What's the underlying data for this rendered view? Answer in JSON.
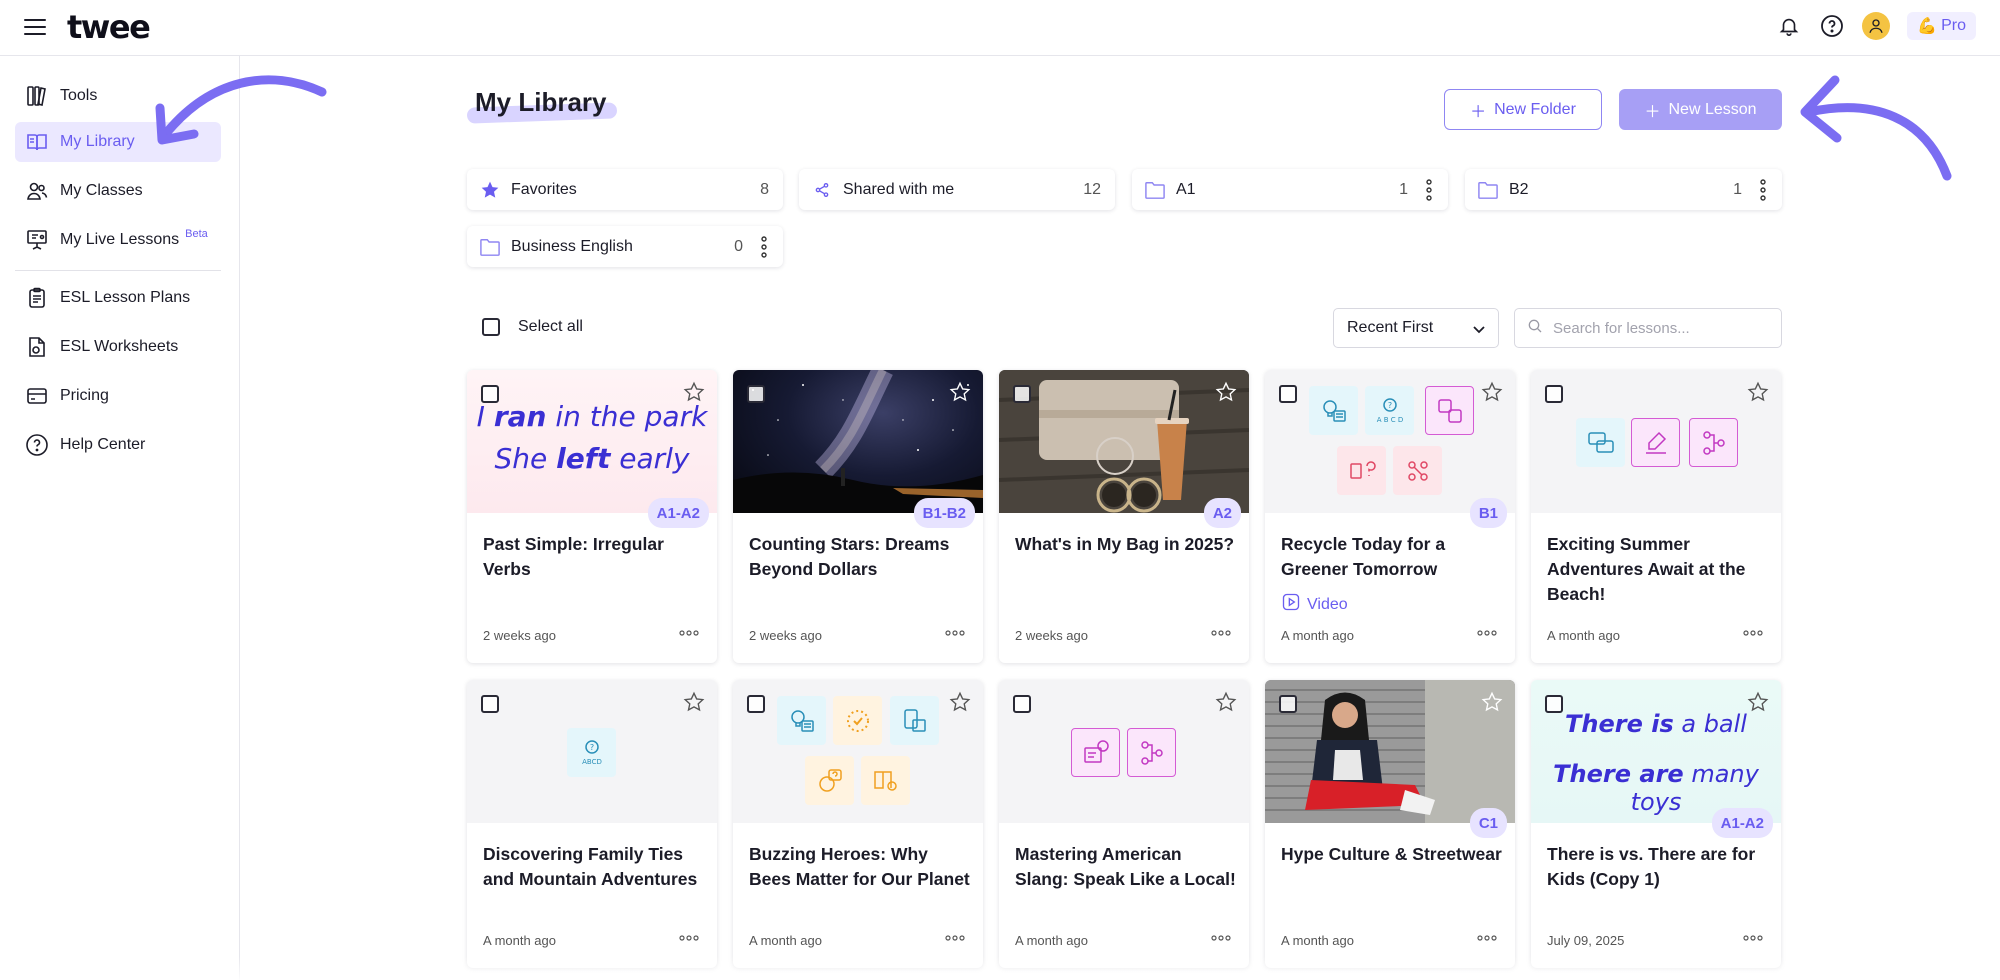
{
  "header": {
    "logo": "twee",
    "pro_label": "Pro",
    "pro_emoji": "💪"
  },
  "sidebar": {
    "items": [
      {
        "label": "Tools",
        "icon": "tools-icon"
      },
      {
        "label": "My Library",
        "icon": "book-icon",
        "active": true
      },
      {
        "label": "My Classes",
        "icon": "users-icon"
      },
      {
        "label": "My Live Lessons",
        "icon": "presentation-icon",
        "badge": "Beta"
      },
      {
        "label": "ESL Lesson Plans",
        "icon": "clipboard-icon"
      },
      {
        "label": "ESL Worksheets",
        "icon": "worksheet-icon"
      },
      {
        "label": "Pricing",
        "icon": "credit-card-icon"
      },
      {
        "label": "Help Center",
        "icon": "help-icon"
      }
    ]
  },
  "main": {
    "title": "My Library",
    "new_folder_label": "New Folder",
    "new_lesson_label": "New Lesson",
    "folders": [
      {
        "label": "Favorites",
        "count": "8",
        "icon": "star-icon"
      },
      {
        "label": "Shared with me",
        "count": "12",
        "icon": "share-icon"
      },
      {
        "label": "A1",
        "count": "1",
        "icon": "folder-icon"
      },
      {
        "label": "B2",
        "count": "1",
        "icon": "folder-icon"
      },
      {
        "label": "Business English",
        "count": "0",
        "icon": "folder-icon"
      }
    ],
    "select_all_label": "Select all",
    "sort_value": "Recent First",
    "search_placeholder": "Search for lessons..."
  },
  "cards": [
    {
      "title": "Past Simple: Irregular Verbs",
      "level": "A1-A2",
      "date": "2 weeks ago",
      "thumb_line1_pre": "I ",
      "thumb_line1_bold": "ran",
      "thumb_line1_post": " in the park",
      "thumb_line2_pre": "She ",
      "thumb_line2_bold": "left",
      "thumb_line2_post": " early"
    },
    {
      "title": "Counting Stars: Dreams Beyond Dollars",
      "level": "B1-B2",
      "date": "2 weeks ago"
    },
    {
      "title": "What's in My Bag in 2025?",
      "level": "A2",
      "date": "2 weeks ago"
    },
    {
      "title": "Recycle Today for a Greener Tomorrow",
      "level": "B1",
      "date": "A month ago",
      "video_label": "Video"
    },
    {
      "title": "Exciting Summer Adventures Await at the Beach!",
      "date": "A month ago"
    },
    {
      "title": "Discovering Family Ties and Mountain Adventures",
      "date": "A month ago",
      "thumb_quiz": "ABCD"
    },
    {
      "title": "Buzzing Heroes: Why Bees Matter for Our Planet",
      "date": "A month ago"
    },
    {
      "title": "Mastering American Slang: Speak Like a Local!",
      "date": "A month ago"
    },
    {
      "title": "Hype Culture & Streetwear",
      "level": "C1",
      "date": "A month ago"
    },
    {
      "title": "There is vs. There are for Kids (Copy 1)",
      "level": "A1-A2",
      "date": "July 09, 2025",
      "thumb_line1_pre": "",
      "thumb_line1_bold": "There is",
      "thumb_line1_post": " a ball",
      "thumb_line2_pre": "",
      "thumb_line2_bold": "There are",
      "thumb_line2_post": " many toys"
    }
  ],
  "colors": {
    "accent": "#6a5df0",
    "accent_light": "#ebe8ff",
    "new_lesson_bg": "#a79ff5"
  }
}
